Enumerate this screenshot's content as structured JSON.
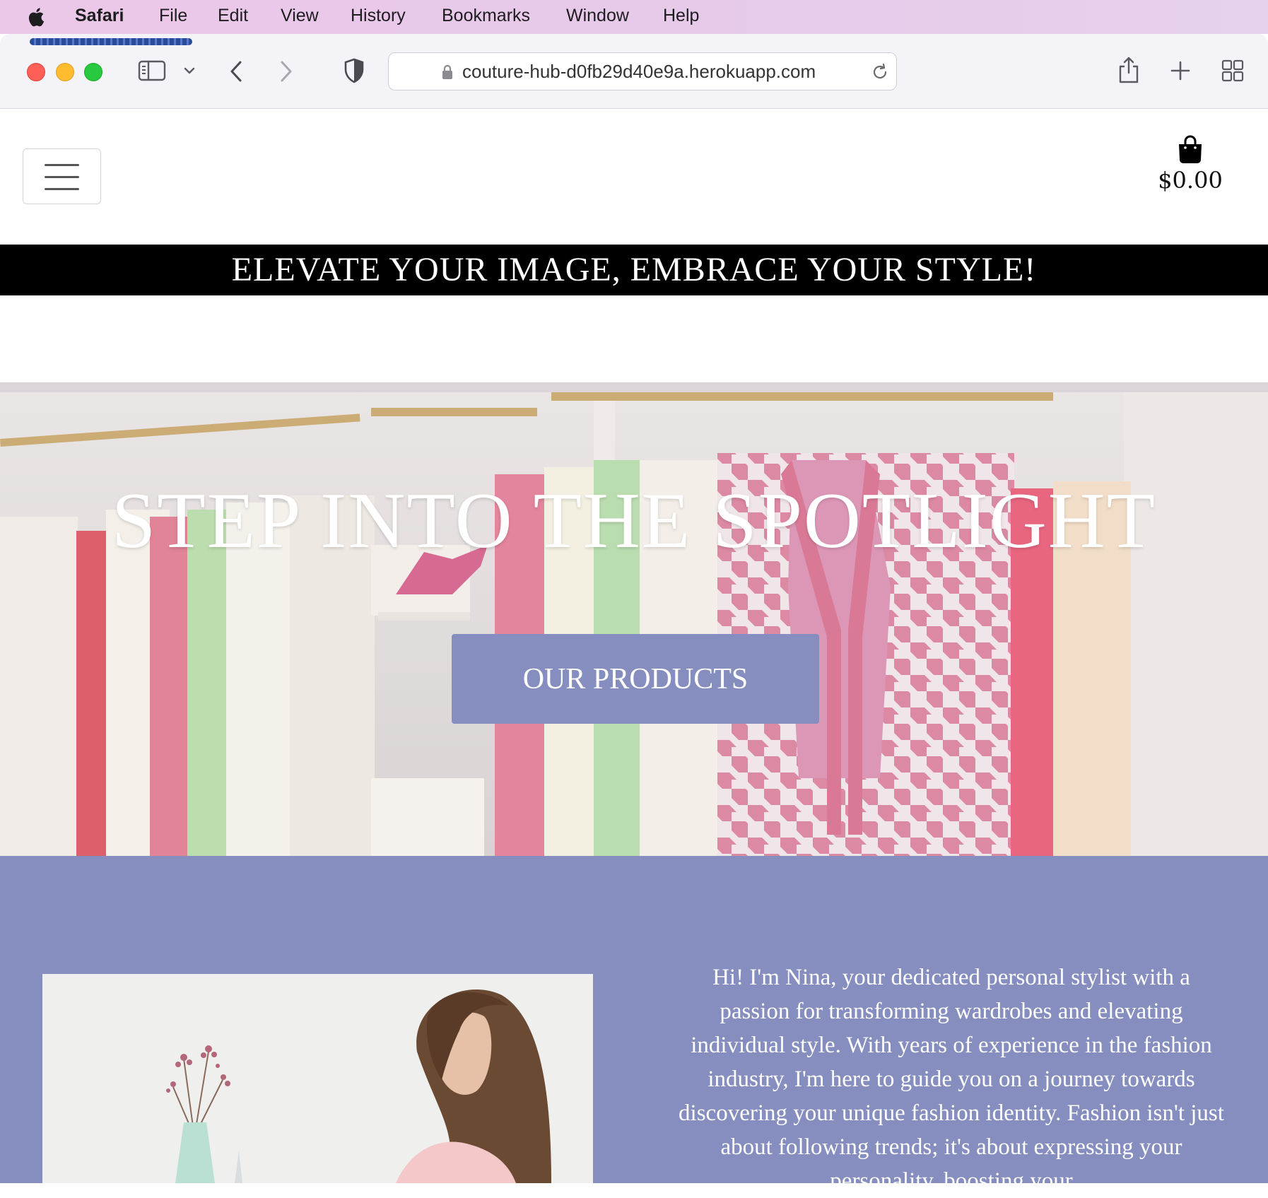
{
  "menubar": {
    "app_name": "Safari",
    "items": [
      "File",
      "Edit",
      "View",
      "History",
      "Bookmarks",
      "Window",
      "Help"
    ]
  },
  "browser": {
    "url": "couture-hub-d0fb29d40e9a.herokuapp.com",
    "icons": [
      "sidebar-icon",
      "chevron-down-icon",
      "back-icon",
      "forward-icon",
      "shield-icon",
      "lock-icon",
      "reload-icon",
      "share-icon",
      "new-tab-icon",
      "tab-overview-icon"
    ]
  },
  "site": {
    "cart_total": "$0.00",
    "banner": "ELEVATE YOUR IMAGE, EMBRACE YOUR STYLE!",
    "hero_title": "STEP INTO THE SPOTLIGHT",
    "cta_label": "OUR PRODUCTS",
    "about_text": "Hi! I'm Nina, your dedicated personal stylist with a passion for transforming wardrobes and elevating individual style. With years of experience in the fashion industry, I'm here to guide you on a journey towards discovering your unique fashion identity. Fashion isn't just about following trends; it's about expressing your personality, boosting your"
  },
  "colors": {
    "accent": "#858ebe",
    "banner_bg": "#000000"
  }
}
